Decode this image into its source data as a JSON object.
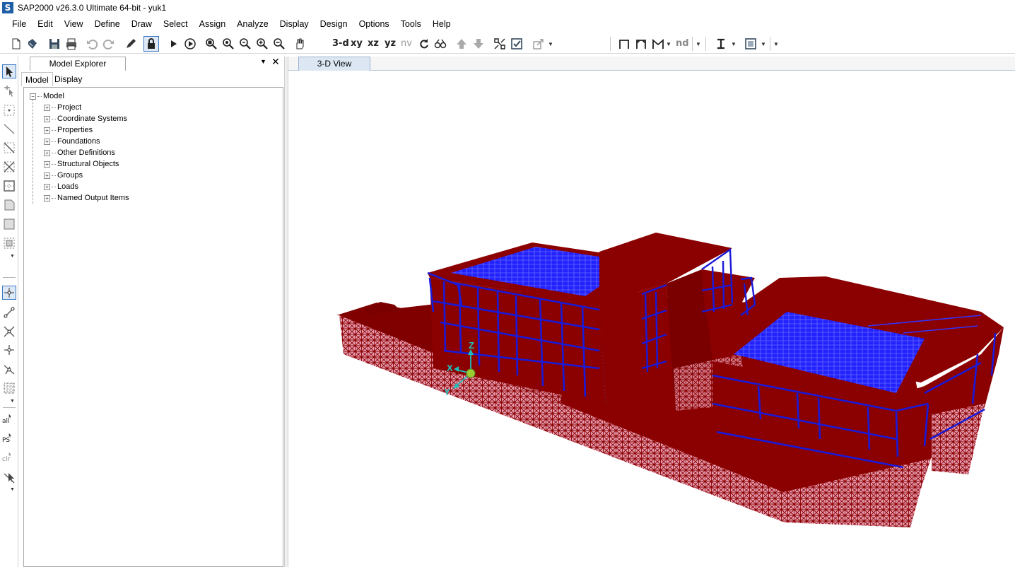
{
  "window": {
    "title": "SAP2000 v26.3.0 Ultimate 64-bit - yuk1",
    "logo_letter": "S"
  },
  "menu": [
    "File",
    "Edit",
    "View",
    "Define",
    "Draw",
    "Select",
    "Assign",
    "Analyze",
    "Display",
    "Design",
    "Options",
    "Tools",
    "Help"
  ],
  "toolbar": {
    "view_3d": "3-d",
    "view_xy": "xy",
    "view_xz": "xz",
    "view_yz": "yz",
    "view_nv": "nv",
    "nd_label": "nd",
    "icons": [
      "new-model-icon",
      "open-icon",
      "save-icon",
      "print-icon",
      "undo-icon",
      "redo-icon",
      "pencil-icon",
      "lock-icon",
      "run-icon",
      "run-step-icon",
      "zoom-window-icon",
      "zoom-restore-icon",
      "zoom-previous-icon",
      "zoom-in-icon",
      "zoom-out-icon",
      "pan-icon",
      "rotate-icon",
      "perspective-icon",
      "move-up-icon",
      "move-down-icon",
      "object-shrink-icon",
      "set-display-icon",
      "extrude-icon",
      "frame-type-icon",
      "i-beam-icon",
      "shell-section-icon"
    ]
  },
  "left_toolbar": {
    "labels": {
      "all": "all",
      "ps": "PS",
      "clr": "clr"
    },
    "icons": [
      "pointer-icon",
      "reshape-icon",
      "draw-point-icon",
      "draw-frame-icon",
      "draw-area-icon",
      "draw-cross-icon",
      "draw-rect-area-icon",
      "draw-poly-area-icon",
      "draw-solid-icon",
      "draw-special-icon",
      "snap-points-icon",
      "snap-ends-icon",
      "snap-intersections-icon",
      "snap-perpendicular-icon",
      "snap-lines-icon",
      "snap-grid-icon",
      "select-all-icon",
      "previous-selection-icon",
      "clear-selection-icon",
      "intersecting-line-icon"
    ]
  },
  "explorer": {
    "title": "Model Explorer",
    "tabs": [
      "Model",
      "Display"
    ],
    "active_tab": "Model",
    "root": "Model",
    "items": [
      "Project",
      "Coordinate Systems",
      "Properties",
      "Foundations",
      "Other Definitions",
      "Structural Objects",
      "Groups",
      "Loads",
      "Named Output Items"
    ]
  },
  "viewport": {
    "tab_label": "3-D View",
    "axes": {
      "z": "Z",
      "x": "X",
      "y": "Y"
    },
    "colors": {
      "solid_red": "#8b0000",
      "mesh_pink": "#e8a0b0",
      "frame_blue": "#1a1ad8",
      "deck_blue": "#2020ff",
      "axis_cyan": "#20c0c0"
    }
  }
}
